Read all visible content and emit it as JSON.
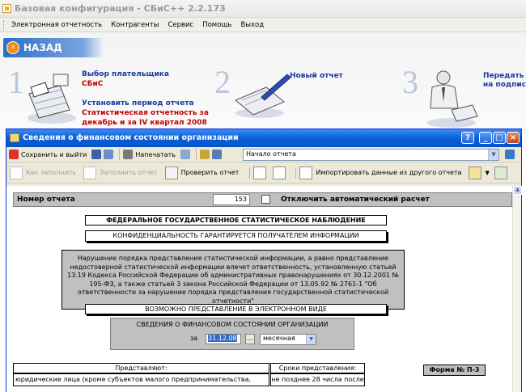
{
  "window": {
    "title": "Базовая конфигурация - СБиС++ 2.2.173"
  },
  "menu": [
    "Электронная отчетность",
    "Контрагенты",
    "Сервис",
    "Помощь",
    "Выход"
  ],
  "wizard": {
    "back_label": "НАЗАД",
    "steps": [
      {
        "number": "1",
        "title": "Выбор плательщика",
        "subtitle": "СБиС",
        "title2": "Установить период отчета",
        "subtitle2": "Статистическая отчетность за декабрь и за IV квартал 2008"
      },
      {
        "number": "2",
        "title": "Новый отчет"
      },
      {
        "number": "3",
        "title": "Передать на подпись"
      }
    ]
  },
  "dialog": {
    "title": "Сведения о финансовом состоянии организации",
    "toolbar1": {
      "save_exit": "Сохранить и выйти",
      "print": "Напечатать",
      "nav_combo": "Начало отчета"
    },
    "toolbar2": {
      "how_to_fill": "Как заполнить",
      "fill_report": "Заполнить отчет",
      "check_report": "Проверить отчет",
      "import_data": "Импортировать данные из другого отчета"
    }
  },
  "form": {
    "report_number_label": "Номер отчета",
    "report_number": "153",
    "auto_calc_label": "Отключить автоматический расчет",
    "heading1": "ФЕДЕРАЛЬНОЕ ГОСУДАРСТВЕННОЕ СТАТИСТИЧЕСКОЕ НАБЛЮДЕНИЕ",
    "heading2": "КОНФИДЕНЦИАЛЬНОСТЬ ГАРАНТИРУЕТСЯ ПОЛУЧАТЕЛЕМ ИНФОРМАЦИИ",
    "notice": "Нарушение порядка представления статистической информации, а равно представление недостоверной статистической информации влечет ответственность, установленную статьей 13.19 Кодекса Российской Федерации об административных правонарушениях от 30.12.2001 № 195-ФЗ, а также статьей 3 закона Российской Федерации от 13.05.92 № 2761-1 \"Об ответственности за нарушение порядка представления государственной статистической отчетности\"",
    "electronic": "ВОЗМОЖНО ПРЕДСТАВЛЕНИЕ В ЭЛЕКТРОННОМ ВИДЕ",
    "period_title": "СВЕДЕНИЯ О ФИНАНСОВОМ СОСТОЯНИИ ОРГАНИЗАЦИИ",
    "period_for": "за",
    "period_date": "31.12.08",
    "period_dots": "...",
    "period_type": "месячная",
    "col_submit": "Представляют:",
    "col_deadline": "Сроки представления:",
    "form_label": "Форма № П-3",
    "row1_submit": "юридические лица (кроме субъектов малого предпринимательства,",
    "row1_deadline": "не позднее 28 числа после"
  }
}
